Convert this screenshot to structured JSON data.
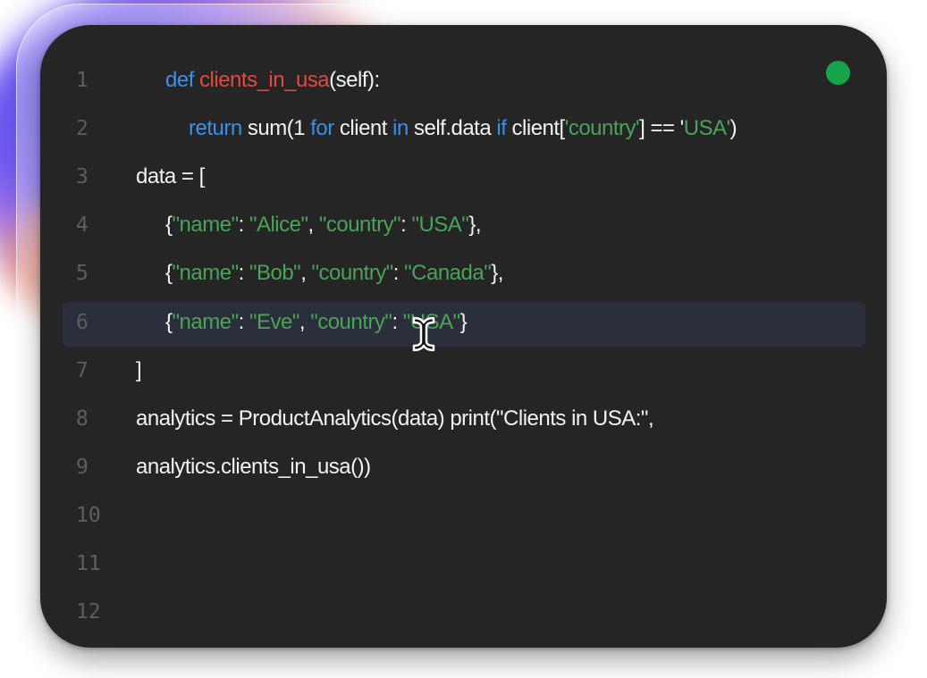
{
  "editor": {
    "status_color": "#16a34a",
    "lines": [
      {
        "num": "1",
        "tokens": [
          "def",
          " ",
          "clients_in_usa",
          "(self):"
        ]
      },
      {
        "num": "2",
        "tokens": [
          "return",
          " sum(1 ",
          "for",
          " client ",
          "in",
          " self.data ",
          "if",
          " client[",
          "'country'",
          "] == '",
          "USA'",
          ")"
        ]
      },
      {
        "num": "3",
        "tokens": [
          "data = ["
        ]
      },
      {
        "num": "4",
        "tokens": [
          "{",
          "\"name\"",
          ": ",
          "\"Alice\"",
          ", ",
          "\"country\"",
          ": ",
          "\"USA\"",
          "},"
        ]
      },
      {
        "num": "5",
        "tokens": [
          "{",
          "\"name\"",
          ": ",
          "\"Bob\"",
          ", ",
          "\"country\"",
          ": ",
          "\"Canada\"",
          "},"
        ]
      },
      {
        "num": "6",
        "tokens": [
          "{",
          "\"name\"",
          ": ",
          "\"Eve\"",
          ", ",
          "\"country\"",
          ": ",
          "\"USA\"",
          "}"
        ]
      },
      {
        "num": "7",
        "tokens": [
          "]"
        ]
      },
      {
        "num": "8",
        "tokens": [
          "analytics = ProductAnalytics(data) print(\"Clients in USA:\","
        ]
      },
      {
        "num": "9",
        "tokens": [
          "analytics.clients_in_usa())"
        ]
      },
      {
        "num": "10",
        "tokens": []
      },
      {
        "num": "11",
        "tokens": []
      },
      {
        "num": "12",
        "tokens": []
      }
    ]
  }
}
